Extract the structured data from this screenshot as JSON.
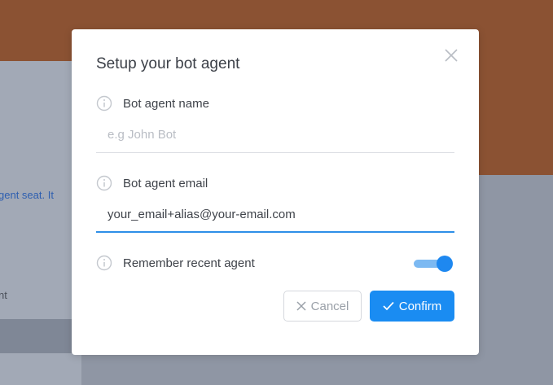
{
  "background": {
    "text_line_1": "gent seat. It",
    "text_line_2": "nt"
  },
  "modal": {
    "title": "Setup your bot agent",
    "close_icon": "close-icon",
    "fields": {
      "name": {
        "label": "Bot agent name",
        "value": "",
        "placeholder": "e.g John Bot",
        "icon": "info-icon"
      },
      "email": {
        "label": "Bot agent email",
        "value": "your_email+alias@your-email.com",
        "placeholder": "",
        "icon": "info-icon"
      },
      "remember": {
        "label": "Remember recent agent",
        "enabled": true,
        "icon": "info-icon"
      }
    },
    "buttons": {
      "cancel_label": "Cancel",
      "cancel_icon": "x-icon",
      "confirm_label": "Confirm",
      "confirm_icon": "check-icon"
    }
  },
  "colors": {
    "accent": "#1a8cf2",
    "header_bg": "#8b5233",
    "overlay_bg": "#8f96a4"
  }
}
